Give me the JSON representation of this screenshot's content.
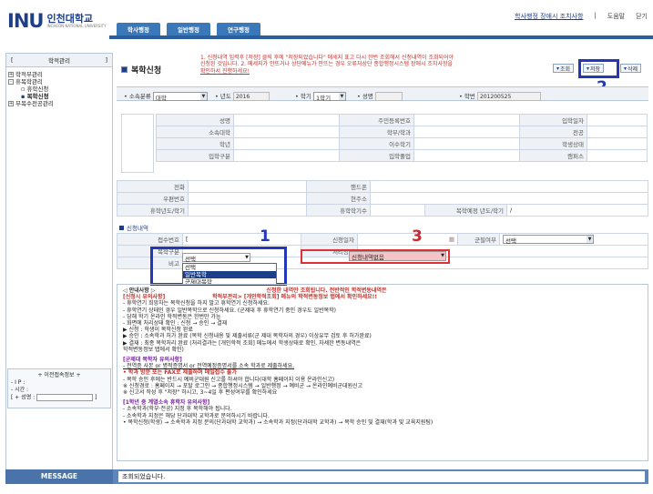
{
  "header": {
    "logo_mark": "INU",
    "logo_name": "인천대학교",
    "logo_sub": "INCHEON NATIONAL UNIVERSITY",
    "tabs": [
      "학사행정",
      "일반행정",
      "연구행정"
    ],
    "link_notice": "학사행정 장애시 조치사항",
    "link_help": "도움말",
    "link_close": "닫기",
    "sep": "|"
  },
  "left": {
    "head_label": "학적관리",
    "bracket_l": "[",
    "bracket_r": "]",
    "tree": [
      {
        "label": "학적부관리",
        "box": "+"
      },
      {
        "label": "휴복학관리",
        "box": "-"
      },
      {
        "label": "휴학신청"
      },
      {
        "label": "복학신청",
        "selected": true
      },
      {
        "label": "부복수전공관리",
        "box": "+"
      }
    ],
    "info_title": "+ 이전접속정보 +",
    "info_ip": "- I P :",
    "info_time": "- 시간 :",
    "info_id_label": "[ + 성명 :",
    "info_id_close": "]"
  },
  "page_title": "복학신청",
  "notice": [
    "1. 신청내역 입력후 [저장] 클릭 후에 \"저장되었습니다\" 메세지 표고 다시 한번 조회해서 신청내역이 조회되어야",
    "신청된 것입니다. 2. 메세지가 안뜨거나 상단메뉴가 안뜨는 경우 오류처상단 종합행정시스템 장애시 조치사항을",
    "확인하서 진행하세요!"
  ],
  "buttons": {
    "search": "조회",
    "save": "저장",
    "delete": "삭제"
  },
  "callouts": {
    "one": "1",
    "two": "2",
    "three": "3"
  },
  "filter": {
    "dept_type_label": "소속분류",
    "dept_type_value": "대학",
    "year_label": "년도",
    "year_value": "2016",
    "term_label": "학기",
    "term_value": "1학기",
    "name_label": "성명",
    "id_label": "학번",
    "id_value": "201200525"
  },
  "grid1": [
    [
      "성명",
      "",
      "주민등록번호",
      "",
      "입학일자",
      ""
    ],
    [
      "소속대학",
      "",
      "학부/학과",
      "",
      "전공",
      ""
    ],
    [
      "학년",
      "",
      "이수학기",
      "",
      "학생상태",
      ""
    ],
    [
      "입학구분",
      "",
      "입학졸업",
      "",
      "캠퍼스",
      ""
    ]
  ],
  "grid2": [
    [
      "전화",
      "",
      "핸드폰",
      ""
    ],
    [
      "우편번호",
      "",
      "현주소",
      ""
    ],
    [
      "휴학년도/학기",
      "",
      "휴학학기수",
      "",
      "복학예정 년도/학기",
      "/"
    ]
  ],
  "section_label": "신청내역",
  "apply": {
    "recv_no_label": "접수번호",
    "recv_no_value": "[",
    "apply_date_label": "신청일자",
    "military_label": "군필여부",
    "military_value": "선택",
    "return_type_label": "복학구분",
    "return_type_value": "선택",
    "process_label": "처리상태",
    "process_value": "신청내역없음",
    "note_label": "비고",
    "options": [
      "선택",
      "일반복학",
      "군제대복학"
    ]
  },
  "guide": {
    "title": "◁ 안내사항 ▷",
    "red_line": "신청한 내역만 조회됩니다. 전반적인 학적변동내역은",
    "purple_line": "학적부관리> [개인학적조회] 메뉴의 학적변동정보 탭에서 확인하세요!!",
    "sec1_head": "[신청시 유의사항]",
    "sec1": [
      "- 휴학연기 희망자는 복학신청을 하지 말고 휴학연기 신청하세요.",
      "- 휴학연기 상태인 경우 일반복학으로 신청하세요. (군제대 후 휴학연기 중인 경우도 일반복학)",
      "- 당해 학기 온라인 학적변동은 한번만 가능",
      "- 화면에 처리상태 확인 : 신청 → 승인 → 결재",
      "▶ 신청 : 학생이 복학신청 완료",
      "▶ 승인 : 소속학과 허가 완료 (복학 신청내용 및 제출서류(군 제대 복학자의 경우) 이상유무 검토 후 허가완료)",
      "▶ 결재 : 최종 복학처리 완료 (처리결과는 [개인학적 조회] 메뉴에서 학생상태로 확인, 자세한 변동내역은",
      "          학적변동정보 탭에서 확인)"
    ],
    "sec2_head": "[군제대 복학자 유의사항]",
    "sec2": [
      "- 전역증 사본 or 병적증명서 or 전역예정증명서를 소속 학과로 제출하세요.",
      "• 학과 방문 또는 FAX로 제출하며 메일접수 불가",
      "- 복학 승인 후에는 반드시 예비군대원 신고를 하셔야 합니다(대학 홈페이지 이용 온라인신고)",
      "  ※ 신청경로 : 홈페이지 → 포탈 로그인 → 종합행정시스템 → 일반행정 → 예비군 → 온라인예비군대원신고",
      "  ※ 신고서 작성 후 \"저장\" 하시고, 3~4일 후 편성여부를 확인하세요"
    ],
    "sec3_head": "[1학년 중 계열소속 휴학자 유의사항]",
    "sec3": [
      "- 소속학과(학부·전공) 지정 후 복학해야 됩니다.",
      "- 소속학과 지정은 해당 단과대학 교학과로 문의하시기 바랍니다.",
      "• 복학신청(학생) → 소속학과 지정 문의(단과대학 교학과) → 소속학과 지정(단과대학 교학과) → 복학 승인 및 결재(학과 및 교육지원팀)"
    ]
  },
  "message": {
    "label": "MESSAGE",
    "text": "조회되었습니다."
  },
  "colors": {
    "accent": "#1d3f8a",
    "callout_blue": "#2437b8",
    "callout_red": "#e03038",
    "alert": "#c4302b"
  }
}
